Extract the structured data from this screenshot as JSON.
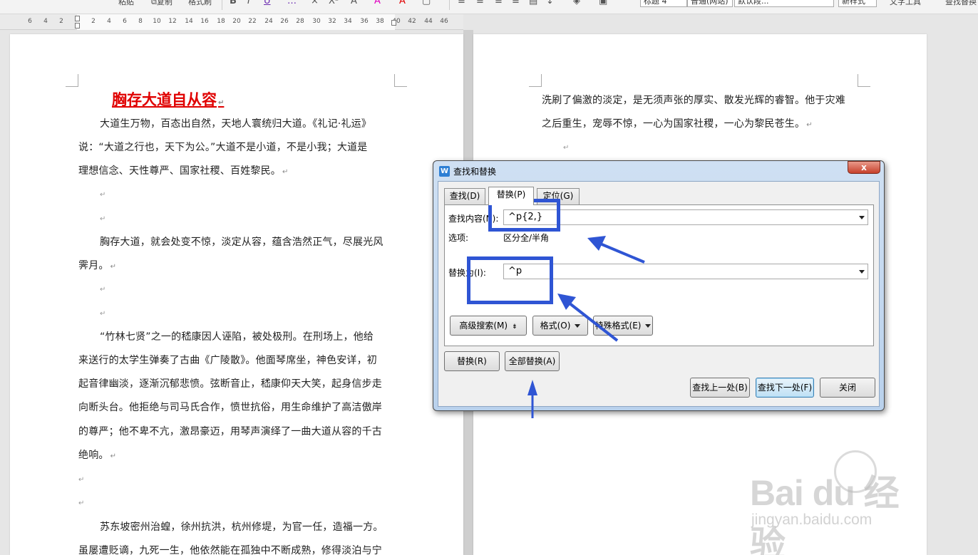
{
  "toolbar": {
    "font_items": [
      "粘贴",
      "复制",
      "格式刷"
    ],
    "format_buttons": [
      "B",
      "I",
      "U",
      "…",
      "×",
      "X²",
      "A",
      "A",
      "A"
    ],
    "style_heading": "标题 4",
    "style_normal": "普通(网站)",
    "style_default": "默认段...",
    "new_style": "新样式",
    "text_tools": "文字工具",
    "find_replace": "查找替换"
  },
  "ruler": {
    "ticks": [
      "6",
      "4",
      "2",
      "2",
      "4",
      "6",
      "8",
      "10",
      "12",
      "14",
      "16",
      "18",
      "20",
      "22",
      "24",
      "26",
      "28",
      "30",
      "32",
      "34",
      "36",
      "38",
      "40",
      "42",
      "44",
      "46"
    ]
  },
  "doc": {
    "title": "胸存大道自从容",
    "left_lines": [
      "大道生万物，百态出自然，天地人寰统归大道。《礼记·礼运》",
      "说：“大道之行也，天下为公。”大道不是小道，不是小我；大道是",
      "理想信念、天性尊严、国家社稷、百姓黎民。",
      "胸存大道，就会处变不惊，淡定从容，蕴含浩然正气，尽展光风",
      "霁月。",
      "“竹林七贤”之一的嵇康因人诬陷，被处极刑。在刑场上，他给",
      "来送行的太学生弹奏了古曲《广陵散》。他面琴席坐，神色安详，初",
      "起音律幽淡，逐渐沉郁悲愤。弦断音止，嵇康仰天大笑，起身信步走",
      "向断头台。他拒绝与司马氏合作，愤世抗俗，用生命维护了高洁傲岸",
      "的尊严；他不卑不亢，激昂豪迈，用琴声演绎了一曲大道从容的千古",
      "绝响。",
      "苏东坡密州治蝗，徐州抗洪，杭州修堤，为官一任，造福一方。",
      "虽屡遭贬谪，九死一生，他依然能在孤独中不断成熟，修得淡泊与宁"
    ],
    "right_lines": [
      "洗刷了偏激的淡定，是无须声张的厚实、散发光辉的睿智。他于灾难",
      "之后重生，宠辱不惊，一心为国家社稷，一心为黎民苍生。"
    ],
    "para_mark": "↵"
  },
  "dialog": {
    "title": "查找和替换",
    "close": "x",
    "tabs": [
      {
        "label": "查找(D)"
      },
      {
        "label": "替换(P)"
      },
      {
        "label": "定位(G)"
      }
    ],
    "find_label": "查找内容(N):",
    "find_value": "^p{2,}",
    "options_label": "选项:",
    "options_value": "区分全/半角",
    "replace_label": "替换为(I):",
    "replace_value": "^p",
    "advanced_button": "高级搜索(M)",
    "format_button": "格式(O)",
    "special_button": "特殊格式(E)",
    "replace_button": "替换(R)",
    "replace_all_button": "全部替换(A)",
    "find_prev_button": "查找上一处(B)",
    "find_next_button": "查找下一处(F)",
    "close_button": "关闭"
  },
  "watermark": {
    "logo_text": "Bai du 经验",
    "url": "jingyan.baidu.com"
  },
  "colors": {
    "title_red": "#e00000",
    "annotation_blue": "#2f55d4"
  }
}
